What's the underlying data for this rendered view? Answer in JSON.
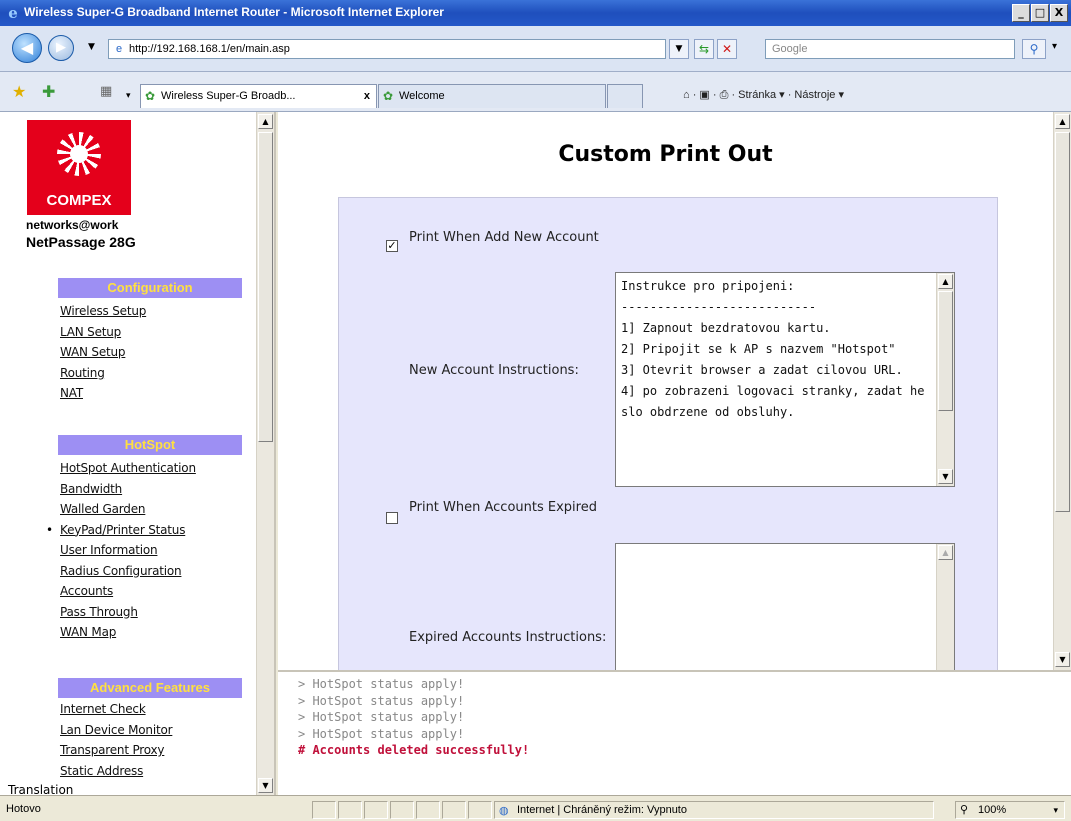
{
  "window": {
    "title": "Wireless Super-G Broadband Internet Router - Microsoft Internet Explorer",
    "min": "_",
    "max": "□",
    "close": "X"
  },
  "browser": {
    "back": "◀",
    "forward": "▶",
    "url": "http://192.168.168.1/en/main.asp",
    "search_placeholder": "Google",
    "tabs": [
      {
        "label": "Wireless Super-G Broadb...",
        "close": "x"
      },
      {
        "label": "Welcome"
      }
    ],
    "commands": "⌂ · ▣ · ⎙ · Stránka ▾ · Nástroje ▾"
  },
  "sidebar": {
    "brand": "COMPEX",
    "tagline": "networks@work",
    "product": "NetPassage 28G",
    "sections": [
      {
        "title": "Configuration",
        "items": [
          "Wireless Setup",
          "LAN Setup",
          "WAN Setup",
          "Routing",
          "NAT"
        ]
      },
      {
        "title": "HotSpot",
        "items": [
          "HotSpot Authentication",
          "Bandwidth",
          "Walled Garden",
          "KeyPad/Printer Status",
          "User Information",
          "Radius Configuration",
          "Accounts",
          "Pass Through",
          "WAN Map"
        ]
      },
      {
        "title": "Advanced Features",
        "items": [
          "Internet Check",
          "Lan Device Monitor",
          "Transparent Proxy",
          "Static Address"
        ]
      }
    ],
    "trailing_text": "Translation"
  },
  "main": {
    "title": "Custom Print Out",
    "print_new": {
      "label": "Print When Add New Account",
      "checked": true
    },
    "new_instructions": {
      "label": "New Account Instructions:",
      "text": "Instrukce pro pripojeni:\n---------------------------\n1] Zapnout bezdratovou kartu.\n2] Pripojit se k AP s nazvem \"Hotspot\"\n3] Otevrit browser a zadat cilovou URL.\n4] po zobrazeni logovaci stranky, zadat heslo obdrzene od obsluhy."
    },
    "print_expired": {
      "label": "Print When Accounts Expired",
      "checked": false
    },
    "expired_instructions": {
      "label": "Expired Accounts Instructions:",
      "text": ""
    }
  },
  "console": {
    "lines": [
      "> HotSpot status apply!",
      "> HotSpot status apply!",
      "> HotSpot status apply!",
      "> HotSpot status apply!"
    ],
    "success": "# Accounts deleted successfully!"
  },
  "statusbar": {
    "left": "Hotovo",
    "zone": "Internet | Chráněný režim: Vypnuto",
    "zoom": "100%"
  },
  "colors": {
    "section_header": "#9d8ff3",
    "section_text": "#ffe040",
    "form_bg": "#e6e6fc",
    "success": "#c0103a",
    "brand_red": "#e4001b"
  }
}
